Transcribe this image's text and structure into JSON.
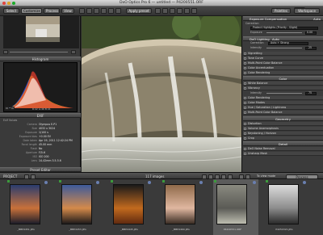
{
  "window": {
    "title": "DxO Optics Pro 6 — untitled — P4200551.ORF"
  },
  "toolbar": {
    "select_label": "Select",
    "customize_label": "Customize",
    "process_label": "Process",
    "view_label": "View",
    "preset_label": "Apply preset",
    "palettes_label": "Palettes",
    "workspace_label": "Workspace",
    "light_label": "Light"
  },
  "left": {
    "histogram_title": "Histogram",
    "histogram_readout": "R:42 G:46 B:41",
    "exif_title": "EXIF",
    "preset_editor_label": "Preset Editor",
    "exif_title2": "Exif Values",
    "exif": [
      {
        "k": "Camera",
        "v": "Olympus E-P1"
      },
      {
        "k": "Size",
        "v": "4032 x 3024"
      },
      {
        "k": "Exposure",
        "v": "1/100 s"
      },
      {
        "k": "Exposure bias",
        "v": "+0.00 EV"
      },
      {
        "k": "Date taken",
        "v": "Apr 19, 2011 12:42:24 PM"
      },
      {
        "k": "Focal length",
        "v": "45.00 mm"
      },
      {
        "k": "Flash",
        "v": "No"
      },
      {
        "k": "Aperture",
        "v": "F/5.6"
      },
      {
        "k": "ISO",
        "v": "ISO 200"
      },
      {
        "k": "Lens",
        "v": "14-42mm 3.5-5.6"
      }
    ]
  },
  "right": {
    "exposure_comp": "Exposure Compensation",
    "auto_label": "Auto",
    "correction_label": "Correction",
    "correction_value": "Protect Highlights (Priority : Slight)",
    "exposure_label": "Exposure",
    "exposure_value": "0.00",
    "dxo_lighting": "DxO Lighting",
    "dxo_lighting_mode": "Auto",
    "lighting_correction_label": "Correction",
    "lighting_correction_value": "Auto + Strong",
    "intensity_label": "Intensity",
    "intensity_value": "25",
    "vignetting": "Vignetting",
    "tone_curve": "Tone Curve",
    "rows_a": [
      "Multi-Point Color Balance",
      "Color Accentuation",
      "Color Rendering"
    ],
    "color_head": "Color",
    "white_balance": "White Balance",
    "vibrancy": "Vibrancy",
    "vibrancy_intensity_label": "Intensity",
    "vibrancy_intensity_value": "75",
    "rows_b": [
      "Color Rendering",
      "Color Modes",
      "Hue / Saturation / Lightness",
      "Multi-Point Color Balance"
    ],
    "geometry_head": "Geometry",
    "rows_c": [
      "Distortion",
      "Volume Anamorphosis",
      "Keystoning / Horizon",
      "Crop"
    ],
    "detail_head": "Detail",
    "rows_d": [
      "DxO Noise Removal",
      "Unsharp Mask"
    ]
  },
  "projectbar": {
    "project_label": "PROJECT",
    "count_label": "117 images",
    "zoom_label": "To view mode",
    "process_label": "Process"
  },
  "filmstrip": [
    {
      "caption": "_MBP4451.JPG",
      "colors": [
        "#2a3c6e",
        "#c8713a",
        "#1d1d2a"
      ]
    },
    {
      "caption": "_MBP4453.JPG",
      "colors": [
        "#3d5a9a",
        "#d48a4a",
        "#1e1a1a"
      ]
    },
    {
      "caption": "_MBP4445.JPG",
      "colors": [
        "#1a1a1a",
        "#c26a1e",
        "#602a10"
      ]
    },
    {
      "caption": "_MBP4460.JPG",
      "colors": [
        "#8f6a4a",
        "#e0b7a0",
        "#3b2d24"
      ]
    },
    {
      "caption": "P4200551.ORF",
      "colors": [
        "#8a8a80",
        "#5a5a55",
        "#bdbdb0"
      ]
    },
    {
      "caption": "P4250321.JPG",
      "colors": [
        "#dcdcdc",
        "#8c8c8c",
        "#2a2a2a"
      ]
    }
  ]
}
